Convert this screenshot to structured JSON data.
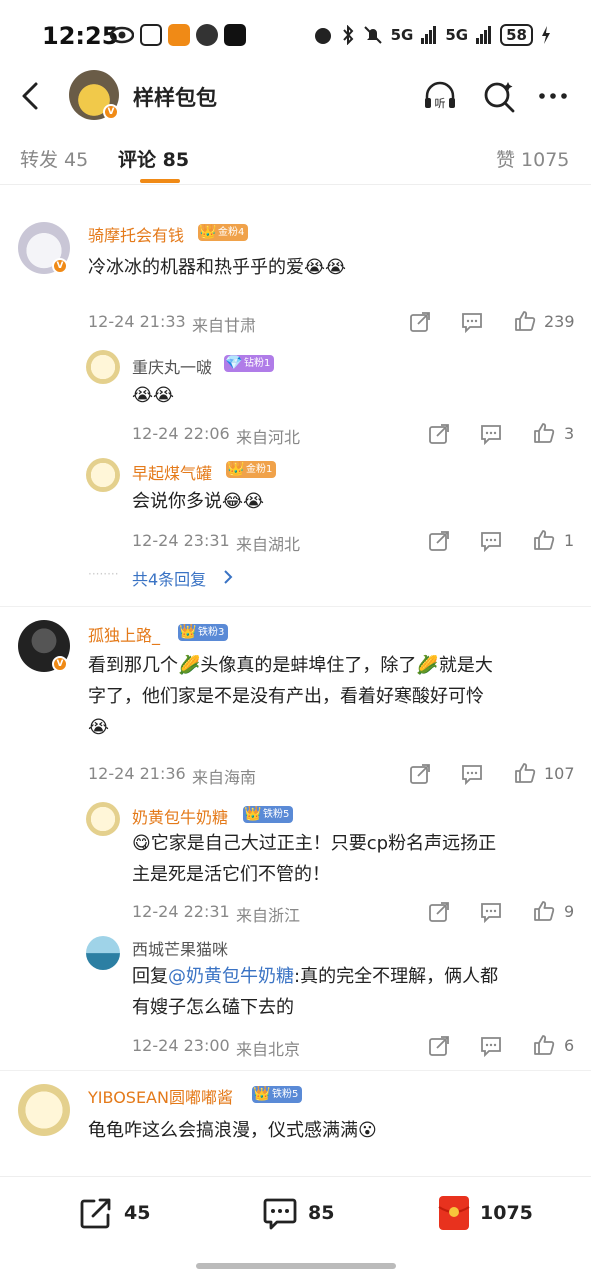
{
  "status": {
    "time": "12:25",
    "battery": "58",
    "net1": "5G",
    "net2": "5G"
  },
  "header": {
    "title": "样样包包"
  },
  "tabs": {
    "repost": "转发 45",
    "comments": "评论 85",
    "likes": "赞 1075"
  },
  "comments": [
    {
      "user": "骑摩托会有钱",
      "badge": "金粉4",
      "text": "冷冰冰的机器和热乎乎的爱😭😭",
      "time": "12-24 21:33",
      "loc": "来自甘肃",
      "likes": "239",
      "replies": [
        {
          "user": "重庆丸一啵",
          "badge": "钻粉1",
          "text": "😭😭",
          "time": "12-24 22:06",
          "loc": "来自河北",
          "likes": "3"
        },
        {
          "user": "早起煤气罐",
          "badge": "金粉1",
          "text": "会说你多说😂😭",
          "time": "12-24 23:31",
          "loc": "来自湖北",
          "likes": "1"
        }
      ],
      "more": "共4条回复"
    },
    {
      "user": "孤独上路_",
      "badge": "铁粉3",
      "text1": "看到那几个🌽头像真的是蚌埠住了，除了🌽就是大",
      "text2": "字了，他们家是不是没有产出，看着好寒酸好可怜",
      "text3": "😭",
      "time": "12-24 21:36",
      "loc": "来自海南",
      "likes": "107",
      "replies": [
        {
          "user": "奶黄包牛奶糖",
          "badge": "铁粉5",
          "text1": "😋它家是自己大过正主！只要cp粉名声远扬正",
          "text2": "主是死是活它们不管的！",
          "time": "12-24 22:31",
          "loc": "来自浙江",
          "likes": "9"
        },
        {
          "user": "西城芒果猫咪",
          "prefix": "回复",
          "mention": "@奶黄包牛奶糖",
          "text1": ":真的完全不理解，俩人都",
          "text2": "有嫂子怎么磕下去的",
          "time": "12-24 23:00",
          "loc": "来自北京",
          "likes": "6"
        }
      ]
    },
    {
      "user": "YIBOSEAN圆嘟嘟酱",
      "badge": "铁粉5",
      "text": "龟龟咋这么会搞浪漫，仪式感满满😮"
    }
  ],
  "bottom": {
    "repost": "45",
    "comments": "85",
    "likes": "1075"
  },
  "colors": {
    "accent": "#f08a16",
    "username": "#e47a1a",
    "mention": "#3a73c4"
  }
}
